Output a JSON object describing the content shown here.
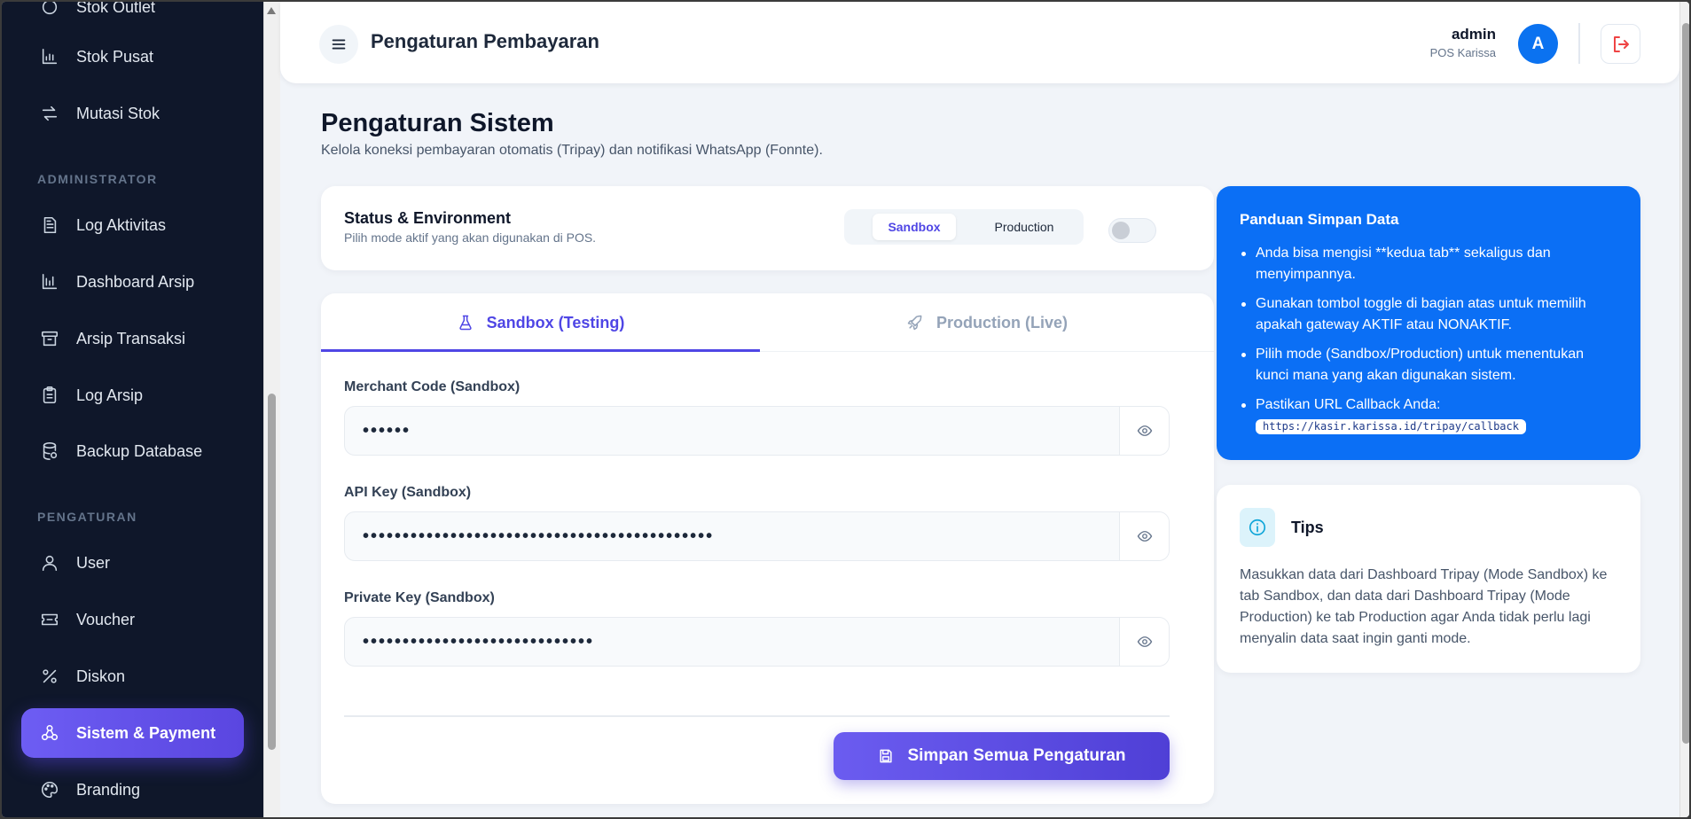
{
  "sidebar": {
    "partial_item": "Stok Outlet",
    "items": [
      {
        "label": "Stok Pusat",
        "icon": "warehouse-chart-icon"
      },
      {
        "label": "Mutasi Stok",
        "icon": "arrows-swap-icon"
      },
      {
        "label": "Log Aktivitas",
        "icon": "document-list-icon"
      },
      {
        "label": "Dashboard Arsip",
        "icon": "bar-chart-icon"
      },
      {
        "label": "Arsip Transaksi",
        "icon": "archive-box-icon"
      },
      {
        "label": "Log Arsip",
        "icon": "clipboard-icon"
      },
      {
        "label": "Backup Database",
        "icon": "database-icon"
      },
      {
        "label": "User",
        "icon": "user-icon"
      },
      {
        "label": "Voucher",
        "icon": "ticket-icon"
      },
      {
        "label": "Diskon",
        "icon": "percent-icon"
      },
      {
        "label": "Sistem & Payment",
        "icon": "webhook-icon"
      },
      {
        "label": "Branding",
        "icon": "palette-icon"
      }
    ],
    "sections": {
      "administrator": "ADMINISTRATOR",
      "pengaturan": "PENGATURAN"
    },
    "active_item": "Sistem & Payment"
  },
  "header": {
    "title": "Pengaturan Pembayaran",
    "user_name": "admin",
    "user_sub": "POS Karissa",
    "avatar_letter": "A"
  },
  "page": {
    "title": "Pengaturan Sistem",
    "subtitle": "Kelola koneksi pembayaran otomatis (Tripay) dan notifikasi WhatsApp (Fonnte)."
  },
  "status": {
    "title": "Status & Environment",
    "subtitle": "Pilih mode aktif yang akan digunakan di POS.",
    "modes": [
      "Sandbox",
      "Production"
    ],
    "selected_mode": "Sandbox",
    "gateway_active": false
  },
  "tabs": [
    {
      "label": "Sandbox (Testing)",
      "icon": "flask-icon",
      "active": true
    },
    {
      "label": "Production (Live)",
      "icon": "rocket-icon",
      "active": false
    }
  ],
  "form": {
    "fields": [
      {
        "label": "Merchant Code (Sandbox)",
        "value": "••••••"
      },
      {
        "label": "API Key (Sandbox)",
        "value": "••••••••••••••••••••••••••••••••••••••••••••"
      },
      {
        "label": "Private Key (Sandbox)",
        "value": "•••••••••••••••••••••••••••••"
      }
    ],
    "save_label": "Simpan Semua Pengaturan"
  },
  "guide": {
    "title": "Panduan Simpan Data",
    "items": [
      "Anda bisa mengisi **kedua tab** sekaligus dan menyimpannya.",
      "Gunakan tombol toggle di bagian atas untuk memilih apakah gateway AKTIF atau NONAKTIF.",
      "Pilih mode (Sandbox/Production) untuk menentukan kunci mana yang akan digunakan sistem.",
      "Pastikan URL Callback Anda:"
    ],
    "callback_url": "https://kasir.karissa.id/tripay/callback"
  },
  "tips": {
    "title": "Tips",
    "text": "Masukkan data dari Dashboard Tripay (Mode Sandbox) ke tab Sandbox, dan data dari Dashboard Tripay (Mode Production) ke tab Production agar Anda tidak perlu lagi menyalin data saat ingin ganti mode."
  },
  "colors": {
    "sidebar_bg": "#0f172a",
    "accent": "#5a46e0",
    "guide_bg": "#0b6ff5",
    "avatar_bg": "#0b72f0",
    "logout": "#ef4444"
  }
}
